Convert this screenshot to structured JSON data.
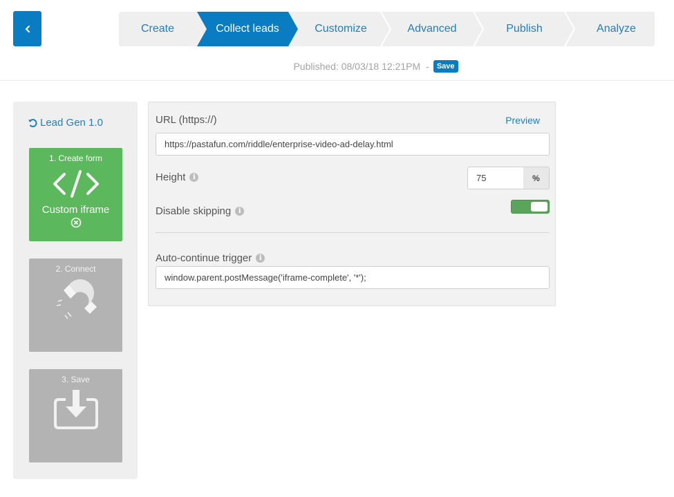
{
  "nav": {
    "back_icon": "chevron-left-icon",
    "steps": [
      {
        "label": "Create",
        "active": false
      },
      {
        "label": "Collect leads",
        "active": true
      },
      {
        "label": "Customize",
        "active": false
      },
      {
        "label": "Advanced",
        "active": false
      },
      {
        "label": "Publish",
        "active": false
      },
      {
        "label": "Analyze",
        "active": false
      }
    ]
  },
  "status": {
    "published_text": "Published: 08/03/18 12:21PM",
    "separator": "-",
    "save_label": "Save"
  },
  "sidebar": {
    "leadgen_label": "Lead Gen 1.0",
    "leadgen_icon": "undo-icon",
    "cards": [
      {
        "title": "1. Create form",
        "icon": "code-icon",
        "label": "Custom iframe",
        "remove_icon": "close-circle-icon",
        "state": "active"
      },
      {
        "title": "2. Connect",
        "icon": "magnet-icon",
        "state": "inactive"
      },
      {
        "title": "3. Save",
        "icon": "download-icon",
        "state": "inactive"
      }
    ]
  },
  "form": {
    "url_label": "URL (https://)",
    "preview_label": "Preview",
    "url_value": "https://pastafun.com/riddle/enterprise-video-ad-delay.html",
    "height_label": "Height",
    "height_value": "75",
    "height_unit": "%",
    "disable_skipping_label": "Disable skipping",
    "disable_skipping_on": true,
    "trigger_label": "Auto-continue trigger",
    "trigger_value": "window.parent.postMessage('iframe-complete', '*');",
    "info_icon": "info-icon"
  },
  "colors": {
    "primary": "#0a7dc2",
    "link": "#1d7fc1",
    "success": "#5cb85c",
    "inactive_card": "#b3b3b3",
    "panel_bg": "#f2f2f2"
  }
}
